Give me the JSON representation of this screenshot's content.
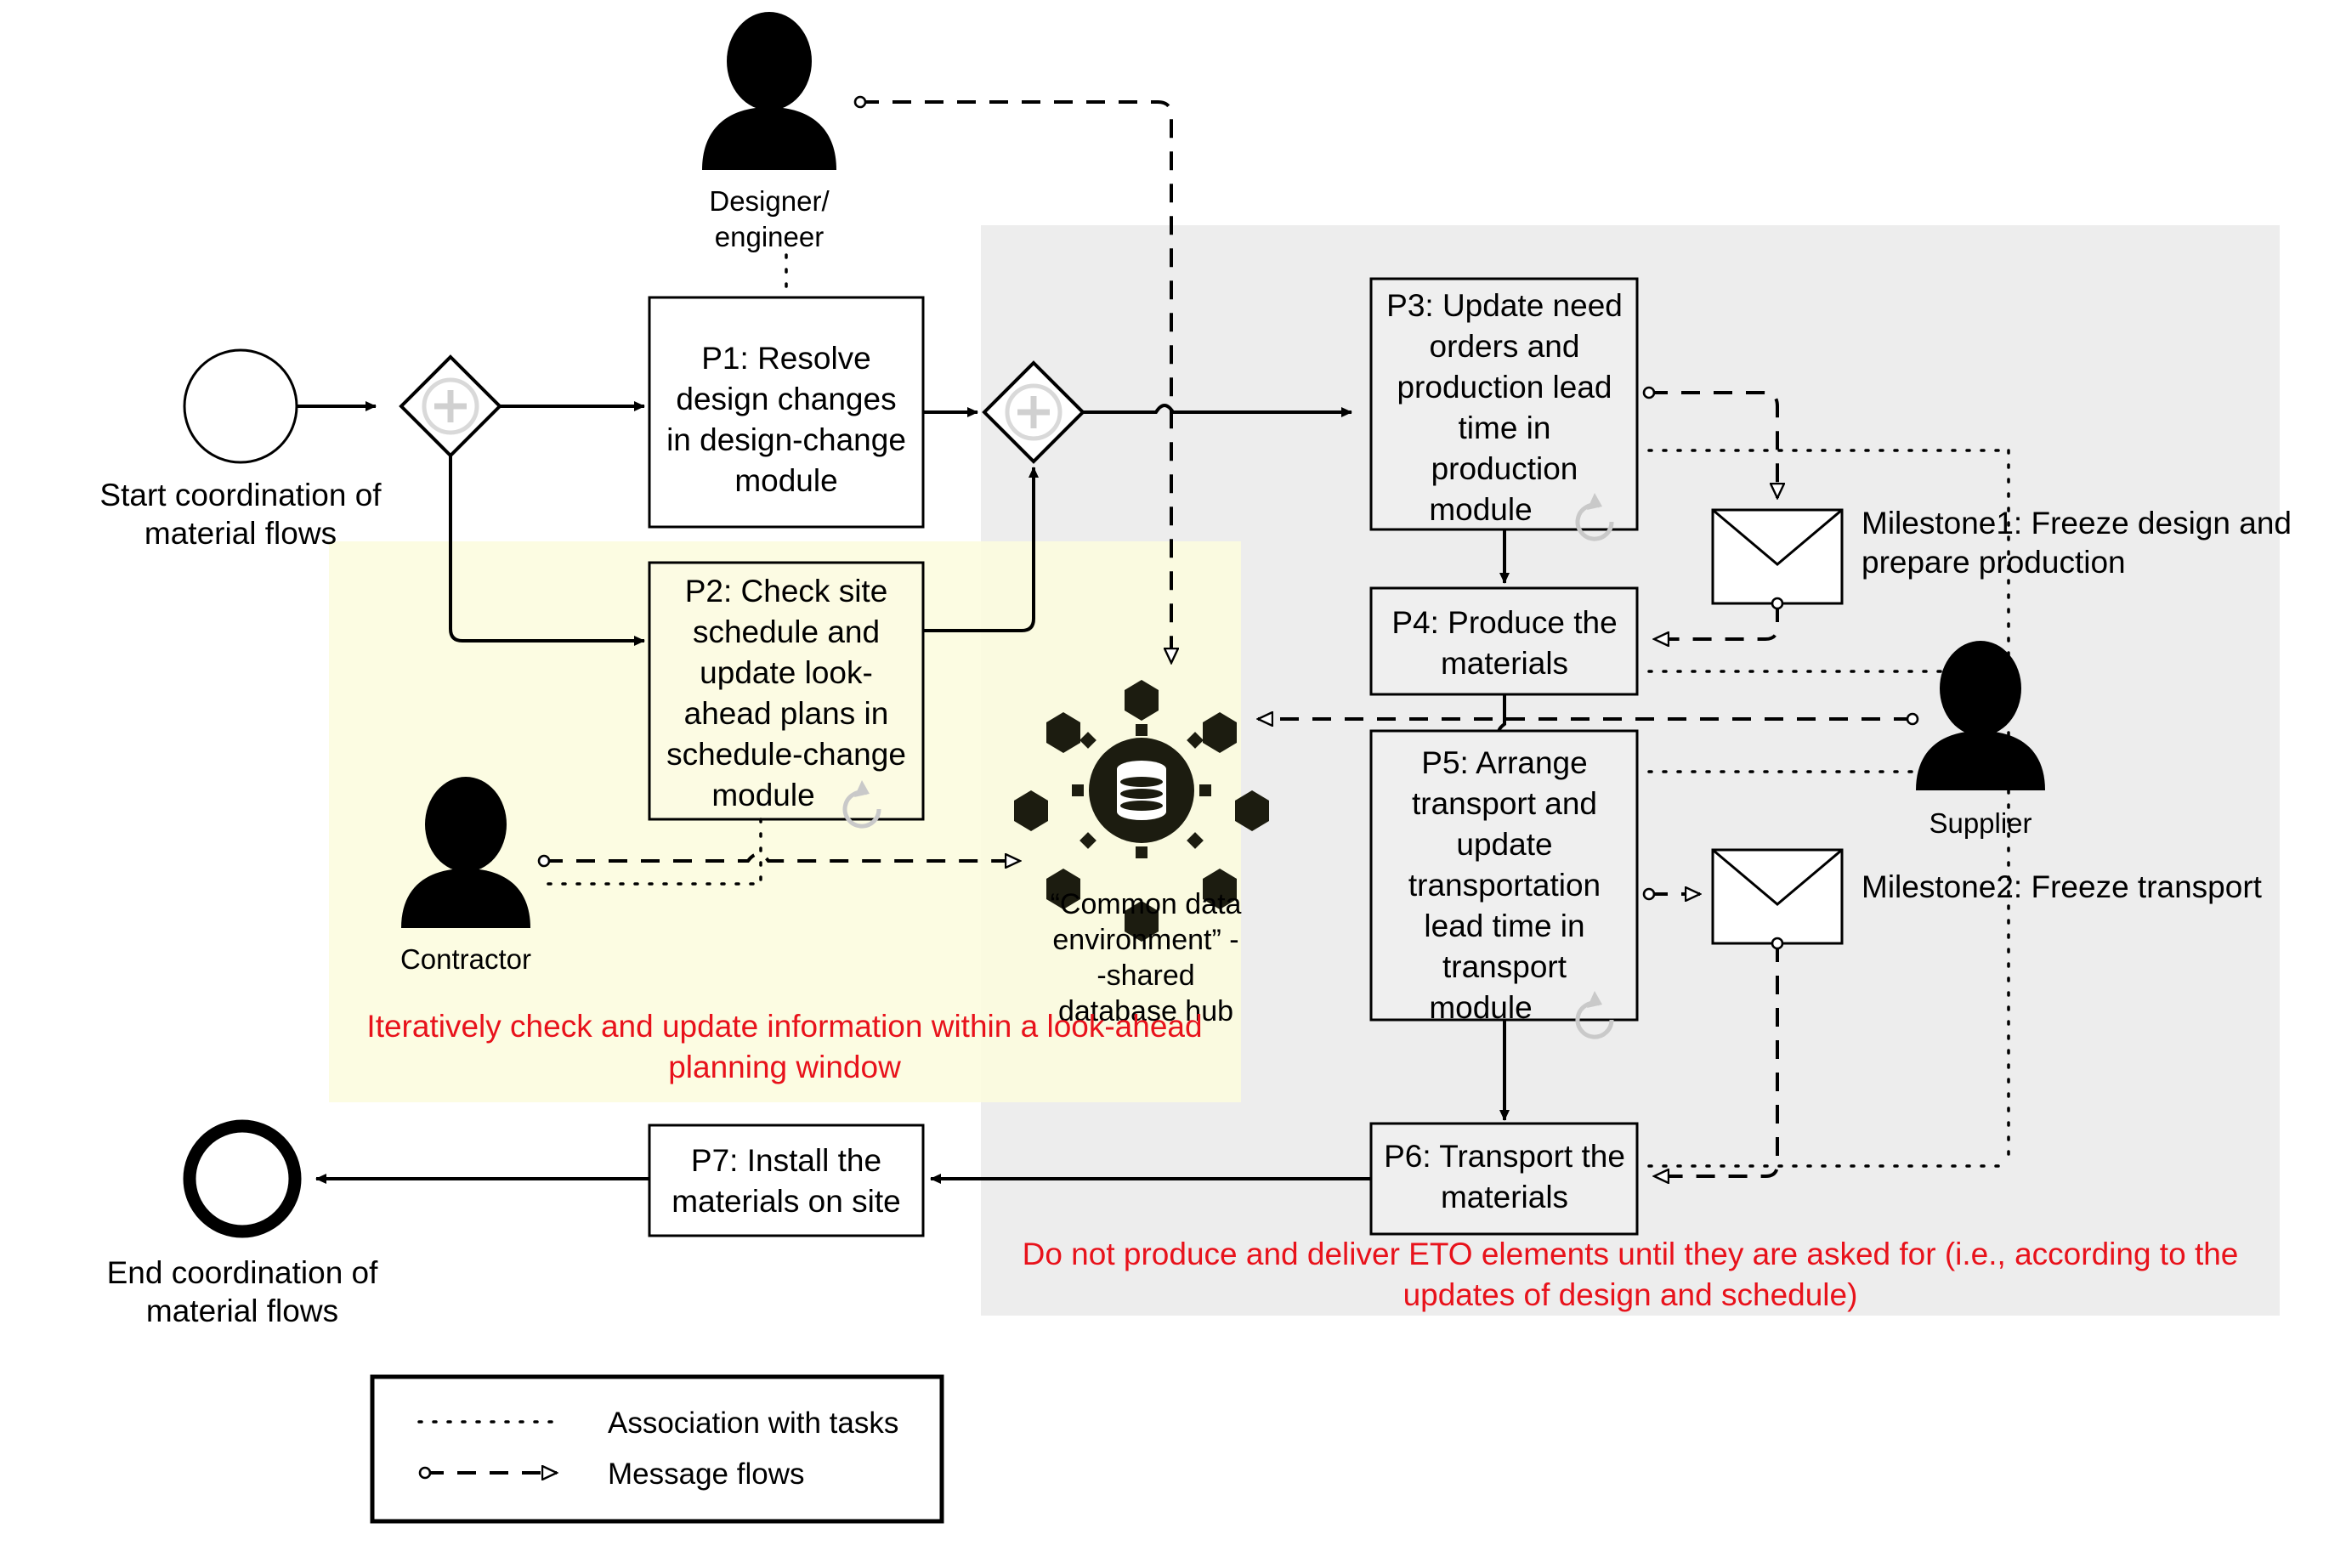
{
  "diagram": {
    "title_type": "BPMN process diagram",
    "regions": {
      "production_zone_color": "#ededed",
      "lookahead_zone_color": "#fbfbdd",
      "note_color": "#e8121b"
    },
    "events": {
      "start": {
        "label": "Start coordination of\nmaterial flows",
        "line1": "Start coordination of",
        "line2": "material flows"
      },
      "end": {
        "label": "End coordination of\nmaterial flows",
        "line1": "End coordination of",
        "line2": "material flows"
      }
    },
    "gateways": [
      {
        "id": "gw1",
        "type": "parallel",
        "symbol": "+"
      },
      {
        "id": "gw2",
        "type": "parallel",
        "symbol": "+"
      }
    ],
    "tasks": [
      {
        "id": "P1",
        "lines": [
          "P1: Resolve",
          "design changes",
          "in design-change",
          "module"
        ],
        "loop": false
      },
      {
        "id": "P2",
        "lines": [
          "P2: Check site",
          "schedule and",
          "update look-",
          "ahead plans in",
          "schedule-change",
          "module"
        ],
        "loop": true
      },
      {
        "id": "P3",
        "lines": [
          "P3: Update need",
          "orders and",
          "production lead",
          "time in",
          "production",
          "module"
        ],
        "loop": true
      },
      {
        "id": "P4",
        "lines": [
          "P4: Produce the",
          "materials"
        ],
        "loop": false
      },
      {
        "id": "P5",
        "lines": [
          "P5: Arrange",
          "transport and",
          "update",
          "transportation",
          "lead time in",
          "transport",
          "module"
        ],
        "loop": true
      },
      {
        "id": "P6",
        "lines": [
          "P6: Transport the",
          "materials"
        ],
        "loop": false
      },
      {
        "id": "P7",
        "lines": [
          "P7: Install the",
          "materials on site"
        ],
        "loop": false
      }
    ],
    "roles": [
      {
        "id": "designer",
        "label_line1": "Designer/",
        "label_line2": "engineer"
      },
      {
        "id": "contractor",
        "label_line1": "Contractor",
        "label_line2": ""
      },
      {
        "id": "supplier",
        "label_line1": "Supplier",
        "label_line2": ""
      }
    ],
    "data_store": {
      "line1": "“Common data",
      "line2": "environment” -",
      "line3": "-shared",
      "line4": "database hub"
    },
    "milestones": [
      {
        "id": "milestone1",
        "line1": "Milestone1: Freeze design and",
        "line2": "prepare production"
      },
      {
        "id": "milestone2",
        "line1": "Milestone2: Freeze transport",
        "line2": ""
      }
    ],
    "notes": [
      {
        "id": "note-lookahead",
        "line1": "Iteratively check and update information within a look-ahead",
        "line2": "planning window"
      },
      {
        "id": "note-eto",
        "line1": "Do not produce and deliver ETO elements until they are asked for (i.e., according to the",
        "line2": "updates of design and schedule)"
      }
    ],
    "legend": {
      "items": [
        {
          "id": "association",
          "label": "Association with tasks",
          "style": "dotted"
        },
        {
          "id": "message-flow",
          "label": "Message flows",
          "style": "dashed-arrow"
        }
      ]
    }
  }
}
